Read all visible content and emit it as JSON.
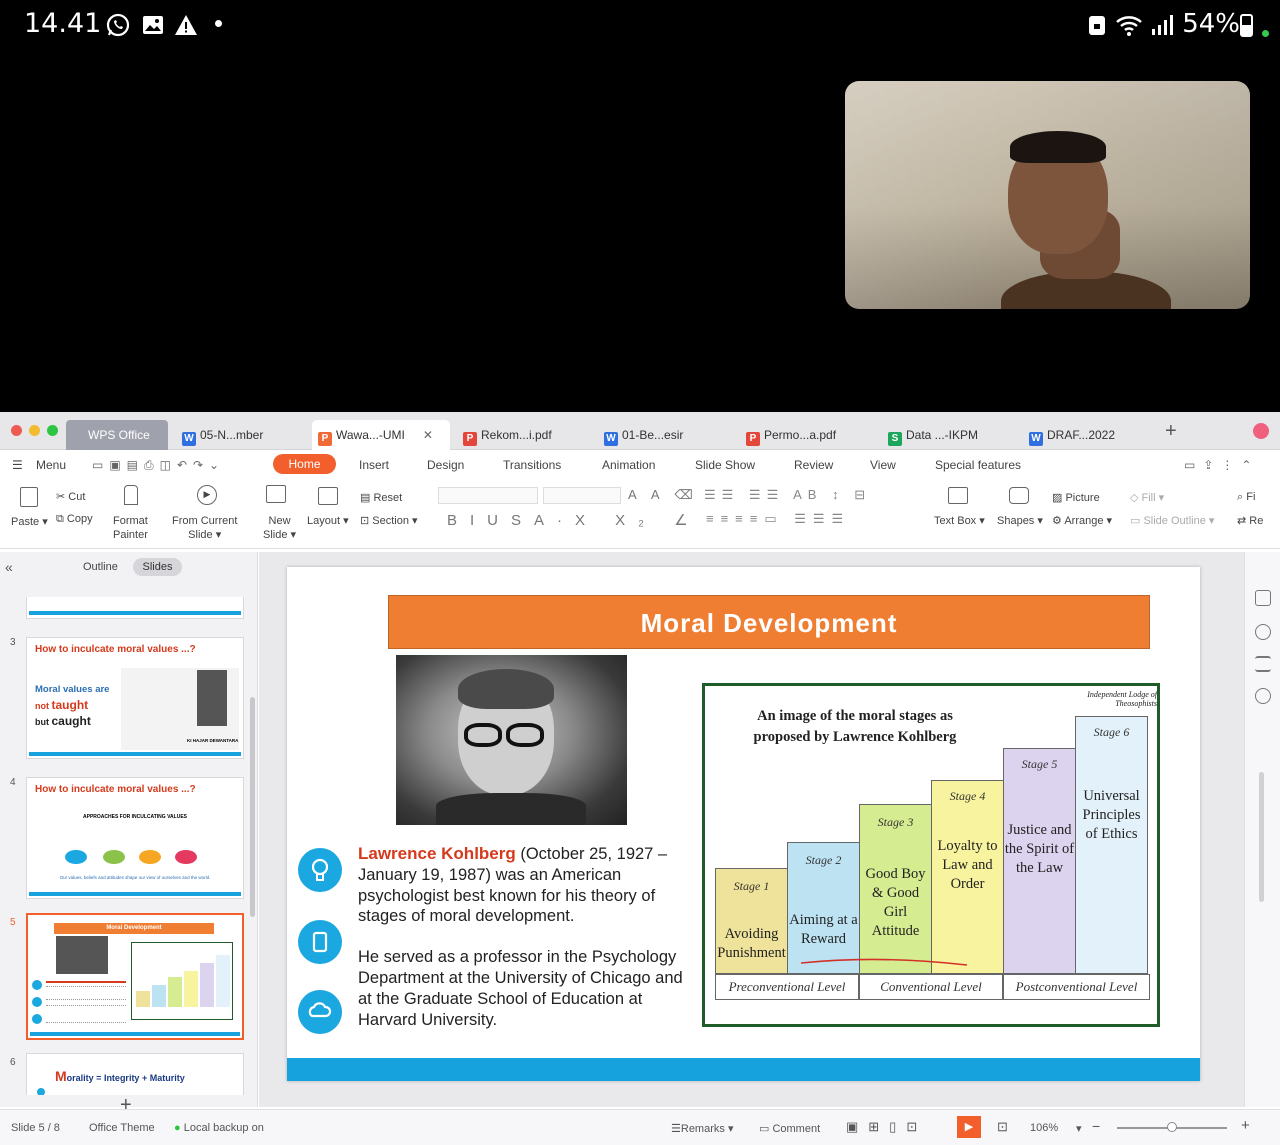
{
  "status": {
    "time": "14.41",
    "battery": "54%"
  },
  "tabs": {
    "wps": "WPS Office",
    "t1": "05-N...mber",
    "t2": "Wawa...-UMI",
    "t3": "Rekom...i.pdf",
    "t4": "01-Be...esir",
    "t5": "Permo...a.pdf",
    "t6": "Data ...-IKPM",
    "t7": "DRAF...2022"
  },
  "menu": {
    "menu": "Menu",
    "home": "Home",
    "insert": "Insert",
    "design": "Design",
    "transitions": "Transitions",
    "animation": "Animation",
    "slideshow": "Slide Show",
    "review": "Review",
    "view": "View",
    "special": "Special features"
  },
  "ribbon": {
    "cut": "Cut",
    "copy": "Copy",
    "paste": "Paste",
    "format": "Format",
    "painter": "Painter",
    "from": "From Current",
    "slide": "Slide",
    "new": "New",
    "newslide": "Slide",
    "layout": "Layout",
    "reset": "Reset",
    "section": "Section",
    "textbox": "Text Box",
    "shapes": "Shapes",
    "picture": "Picture",
    "arrange": "Arrange",
    "fill": "Fill",
    "outline": "Slide Outline",
    "fi": "Fi",
    "re": "Re"
  },
  "panel": {
    "outline": "Outline",
    "slides": "Slides"
  },
  "thumbs": {
    "s3": {
      "num": "3",
      "title": "How to inculcate moral values ...?",
      "l1": "Moral values are",
      "l2a": "not ",
      "l2b": "taught",
      "l3a": "but ",
      "l3b": "caught",
      "author": "KI HAJAR DEWANTARA"
    },
    "s4": {
      "num": "4",
      "title": "How to inculcate moral values ...?",
      "sub": "APPROACHES FOR INCULCATING VALUES",
      "foot": "Our values, beliefs and attitudes shape our view of ourselves and the world."
    },
    "s5": {
      "num": "5",
      "title": "Moral  Development"
    },
    "s6": {
      "num": "6",
      "title_m": "M",
      "title_rest": "orality = Integrity + Maturity"
    }
  },
  "slide": {
    "title": "Moral  Development",
    "name": "Lawrence Kohlberg",
    "p1": " (October 25, 1927 – January 19, 1987) was an American psychologist best known for his theory of stages of moral development.",
    "p2": "He served as a professor in the Psychology Department at the University of Chicago and at the Graduate School of Education at Harvard University.",
    "diagram": {
      "source": "Independent Lodge of Theosophists",
      "cap1": "An image of the moral stages as",
      "cap2": "proposed by Lawrence Kohlberg",
      "stages": [
        {
          "label": "Stage 1",
          "text": "Avoiding Punishment",
          "color": "#efe29a"
        },
        {
          "label": "Stage 2",
          "text": "Aiming at a Reward",
          "color": "#bde3f3"
        },
        {
          "label": "Stage 3",
          "text": "Good Boy & Good Girl Attitude",
          "color": "#d6ec90"
        },
        {
          "label": "Stage 4",
          "text": "Loyalty to Law and Order",
          "color": "#f7f39e"
        },
        {
          "label": "Stage 5",
          "text": "Justice and the Spirit of the Law",
          "color": "#dcd3ee"
        },
        {
          "label": "Stage 6",
          "text": "Universal Principles of Ethics",
          "color": "#e3f2fa"
        }
      ],
      "levels": [
        "Preconventional Level",
        "Conventional Level",
        "Postconventional Level"
      ]
    }
  },
  "statusbar": {
    "slide": "Slide 5 / 8",
    "theme": "Office Theme",
    "backup": "Local backup on",
    "remarks": "Remarks",
    "comment": "Comment",
    "zoom": "106%"
  }
}
